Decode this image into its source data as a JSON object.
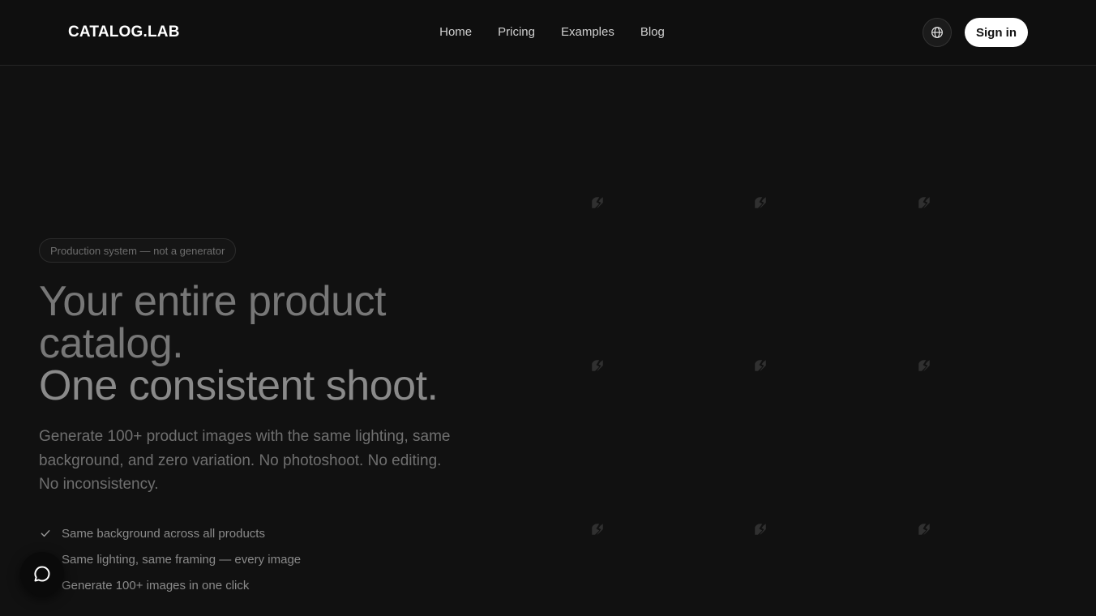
{
  "header": {
    "logo": "CATALOG.LAB",
    "nav": [
      "Home",
      "Pricing",
      "Examples",
      "Blog"
    ],
    "language_icon": "globe-icon",
    "signin_label": "Sign in"
  },
  "hero": {
    "badge": "Production system — not a generator",
    "headline_line1": "Your entire product catalog.",
    "headline_line2": "One consistent shoot.",
    "subcopy": "Generate 100+ product images with the same lighting, same background, and zero variation. No photoshoot. No editing. No inconsistency.",
    "features": [
      "Same background across all products",
      "Same lighting, same framing — every image",
      "Generate 100+ images in one click"
    ],
    "feature_icon": "check-icon"
  },
  "gallery": {
    "placeholder_icon": "broken-image-icon",
    "placeholder_count": 9
  },
  "chat": {
    "icon": "chat-bubble-icon"
  },
  "colors": {
    "background": "#111111",
    "header_bg": "#0f0f0f",
    "button_bg": "#ffffff",
    "muted_text": "#6f6f6f"
  }
}
